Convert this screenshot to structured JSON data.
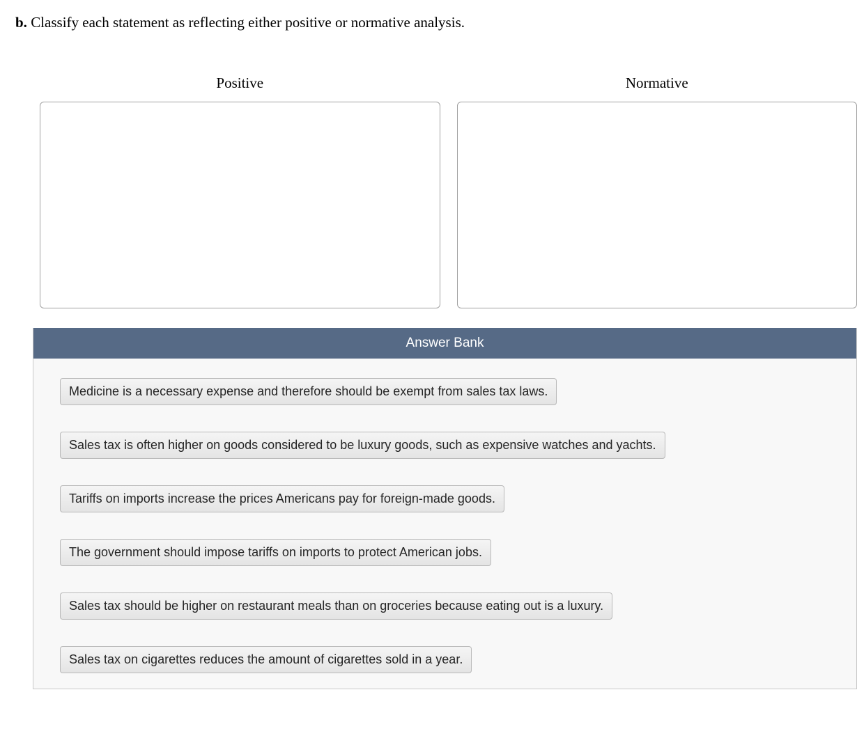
{
  "question": {
    "part_label": "b.",
    "text": "Classify each statement as reflecting either positive or normative analysis."
  },
  "drop_zones": [
    {
      "label": "Positive"
    },
    {
      "label": "Normative"
    }
  ],
  "answer_bank": {
    "header": "Answer Bank",
    "items": [
      "Medicine is a necessary expense and therefore should be exempt from sales tax laws.",
      "Sales tax is often higher on goods considered to be luxury goods, such as expensive watches and yachts.",
      "Tariffs on imports increase the prices Americans pay for foreign-made goods.",
      "The government should impose tariffs on imports to protect American jobs.",
      "Sales tax should be higher on restaurant meals than on groceries because eating out is a luxury.",
      "Sales tax on cigarettes reduces the amount of cigarettes sold in a year."
    ]
  }
}
